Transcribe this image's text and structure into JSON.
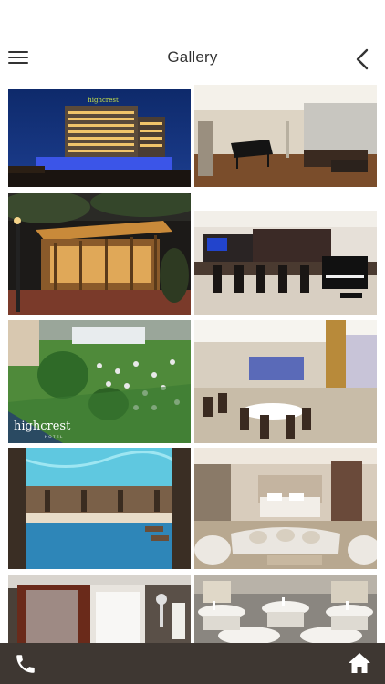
{
  "header": {
    "title": "Gallery",
    "menu_icon": "hamburger-menu-icon",
    "back_icon": "chevron-left-icon"
  },
  "gallery": {
    "images": [
      {
        "subject": "hotel-exterior-night",
        "logo": "highcrest"
      },
      {
        "subject": "lobby-with-grand-piano"
      },
      {
        "subject": "outdoor-bar-pergola"
      },
      {
        "subject": "indoor-bar-with-piano"
      },
      {
        "subject": "garden-aerial-view",
        "logo": "highcrest",
        "logo_sub": "HOTEL"
      },
      {
        "subject": "restaurant-dining-room"
      },
      {
        "subject": "indoor-swimming-pool"
      },
      {
        "subject": "guest-bedroom-suite"
      },
      {
        "subject": "sauna-and-shower"
      },
      {
        "subject": "banquet-hall-tables"
      }
    ]
  },
  "bottom_bar": {
    "phone_icon": "phone-icon",
    "home_icon": "home-icon",
    "bar_color": "#3e3732"
  }
}
